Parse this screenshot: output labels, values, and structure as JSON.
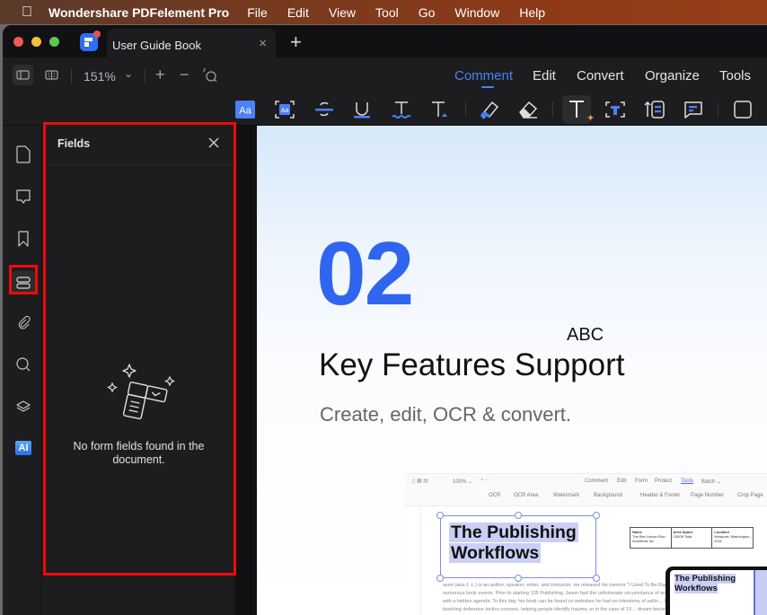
{
  "menubar": {
    "apple_icon": "apple-icon",
    "app_name": "Wondershare PDFelement Pro",
    "items": [
      "File",
      "Edit",
      "View",
      "Tool",
      "Go",
      "Window",
      "Help"
    ]
  },
  "window": {
    "traffic_lights": {
      "close": "#ee5a52",
      "minimize": "#f5be3c",
      "zoom": "#5dc84c"
    },
    "tab": {
      "title": "User Guide Book",
      "close": "×"
    },
    "new_tab": "+"
  },
  "toolbar": {
    "zoom_level": "151%",
    "zoom_in": "+",
    "zoom_out": "−",
    "nav_tabs": [
      {
        "label": "Comment",
        "active": true
      },
      {
        "label": "Edit",
        "active": false
      },
      {
        "label": "Convert",
        "active": false
      },
      {
        "label": "Organize",
        "active": false
      },
      {
        "label": "Tools",
        "active": false
      }
    ],
    "comment_tools": [
      "highlight-text",
      "area-highlight",
      "strikethrough",
      "underline",
      "squiggly",
      "insert-text",
      "pen",
      "eraser",
      "typewriter",
      "text-box",
      "callout",
      "sticky-note",
      "shape"
    ],
    "accent_color": "#4b82f5"
  },
  "left_sidebar": {
    "items": [
      "pages",
      "comments",
      "bookmarks",
      "fields",
      "attachments",
      "search",
      "layers",
      "ai"
    ],
    "active": "fields",
    "ai_label": "AI"
  },
  "fields_panel": {
    "title": "Fields",
    "empty_message": "No form fields found in the document."
  },
  "document": {
    "section_number": "02",
    "label_abc": "ABC",
    "heading": "Key Features Support",
    "subheading": "Create, edit, OCR & convert.",
    "screenshot": {
      "tabs": [
        "Comment",
        "Edit",
        "Form",
        "Protect",
        "Tools",
        "Batch ⌄"
      ],
      "zoom": "100% ⌄",
      "tools": [
        "OCR",
        "OCR Area",
        "Watermark",
        "Background",
        "Header & Footer",
        "Page Number",
        "Crop Page"
      ],
      "title_line1": "The Publishing",
      "title_line2": "Workflows",
      "table": {
        "headers": [
          "Name",
          "Area Space",
          "Location"
        ],
        "values": [
          "The Bex House Elan Architects Inc",
          "1500ft Total",
          "Westport, Washington, USA"
        ]
      },
      "paragraph": "ason (aka J. L.) is an author, speaker, writer, and instructor. He released his memoir \"I Used To Be Racist\" in 20… numerous book events. Prior to starting 105 Publishing, Jason had the unfortunate circumstance of working w… promises with a hidden agenda. To this day, his book can be found on websites he had no intentions of sellin… helping people. From teaching defensive tactics courses, helping people identify trauma, or in the case of 10… dream become a reality without a catch."
    }
  },
  "annotation_color": "#f00a0a"
}
